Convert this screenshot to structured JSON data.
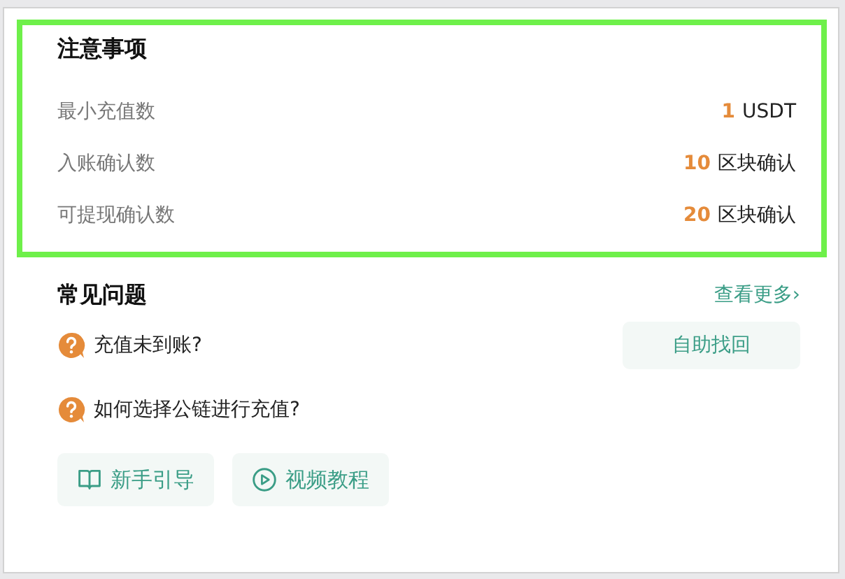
{
  "notes": {
    "title": "注意事项",
    "items": [
      {
        "label": "最小充值数",
        "value": "1",
        "unit": "USDT"
      },
      {
        "label": "入账确认数",
        "value": "10",
        "unit": "区块确认"
      },
      {
        "label": "可提现确认数",
        "value": "20",
        "unit": "区块确认"
      }
    ]
  },
  "faq": {
    "title": "常见问题",
    "more_link": "查看更多›",
    "questions": [
      {
        "text": "充值未到账?",
        "action": "自助找回"
      },
      {
        "text": "如何选择公链进行充值?"
      }
    ],
    "buttons": [
      {
        "kind": "book",
        "label": "新手引导"
      },
      {
        "kind": "play",
        "label": "视频教程"
      }
    ]
  }
}
